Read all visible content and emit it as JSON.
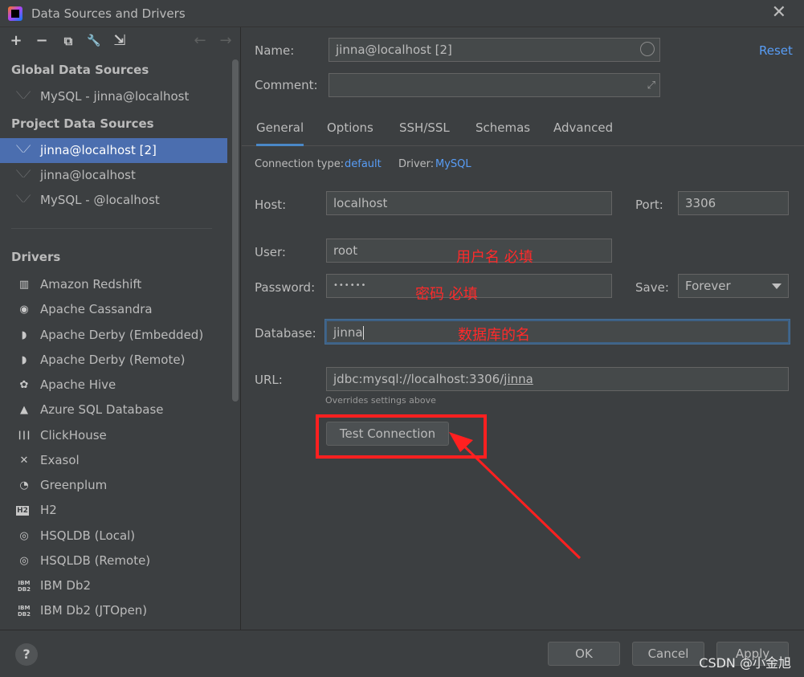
{
  "window": {
    "title": "Data Sources and Drivers",
    "close_glyph": "✕"
  },
  "toolbar": {
    "add": "+",
    "remove": "−",
    "copy": "⧉",
    "wrench": "🔧",
    "import": "⇲",
    "back": "←",
    "forward": "→"
  },
  "sidebar": {
    "global_title": "Global Data Sources",
    "global_items": [
      {
        "label": "MySQL - jinna@localhost"
      }
    ],
    "project_title": "Project Data Sources",
    "project_items": [
      {
        "label": "jinna@localhost [2]",
        "selected": true
      },
      {
        "label": "jinna@localhost"
      },
      {
        "label": "MySQL - @localhost"
      }
    ],
    "drivers_title": "Drivers",
    "drivers": [
      {
        "label": "Amazon Redshift",
        "icon": "▥"
      },
      {
        "label": "Apache Cassandra",
        "icon": "◉"
      },
      {
        "label": "Apache Derby (Embedded)",
        "icon": "◗"
      },
      {
        "label": "Apache Derby (Remote)",
        "icon": "◗"
      },
      {
        "label": "Apache Hive",
        "icon": "✿"
      },
      {
        "label": "Azure SQL Database",
        "icon": "▲"
      },
      {
        "label": "ClickHouse",
        "icon": "┃┃┃"
      },
      {
        "label": "Exasol",
        "icon": "✕"
      },
      {
        "label": "Greenplum",
        "icon": "◔"
      },
      {
        "label": "H2",
        "icon": "H2"
      },
      {
        "label": "HSQLDB (Local)",
        "icon": "◎"
      },
      {
        "label": "HSQLDB (Remote)",
        "icon": "◎"
      },
      {
        "label": "IBM Db2",
        "icon": "IBM DB2"
      },
      {
        "label": "IBM Db2 (JTOpen)",
        "icon": "IBM DB2"
      }
    ]
  },
  "form": {
    "name_label": "Name:",
    "name_value": "jinna@localhost [2]",
    "comment_label": "Comment:",
    "comment_value": "",
    "reset_link": "Reset",
    "tabs": [
      "General",
      "Options",
      "SSH/SSL",
      "Schemas",
      "Advanced"
    ],
    "connection_type_label": "Connection type:",
    "connection_type_value": "default",
    "driver_label": "Driver:",
    "driver_value": "MySQL",
    "host_label": "Host:",
    "host_value": "localhost",
    "port_label": "Port:",
    "port_value": "3306",
    "user_label": "User:",
    "user_value": "root",
    "password_label": "Password:",
    "password_value": "••••••",
    "save_label": "Save:",
    "save_value": "Forever",
    "database_label": "Database:",
    "database_value": "jinna",
    "url_label": "URL:",
    "url_value_prefix": "jdbc:mysql://localhost:3306/",
    "url_value_db": "jinna",
    "url_hint": "Overrides settings above",
    "test_connection": "Test Connection"
  },
  "annotations": {
    "user_note": "用户名  必填",
    "password_note": "密码 必填",
    "database_note": "数据库的名"
  },
  "footer": {
    "help": "?",
    "ok": "OK",
    "cancel": "Cancel",
    "apply": "Apply",
    "watermark": "CSDN @小金旭"
  },
  "colors": {
    "accent": "#4b6eaf",
    "link": "#589df6",
    "annotation": "#ff2a2a"
  }
}
